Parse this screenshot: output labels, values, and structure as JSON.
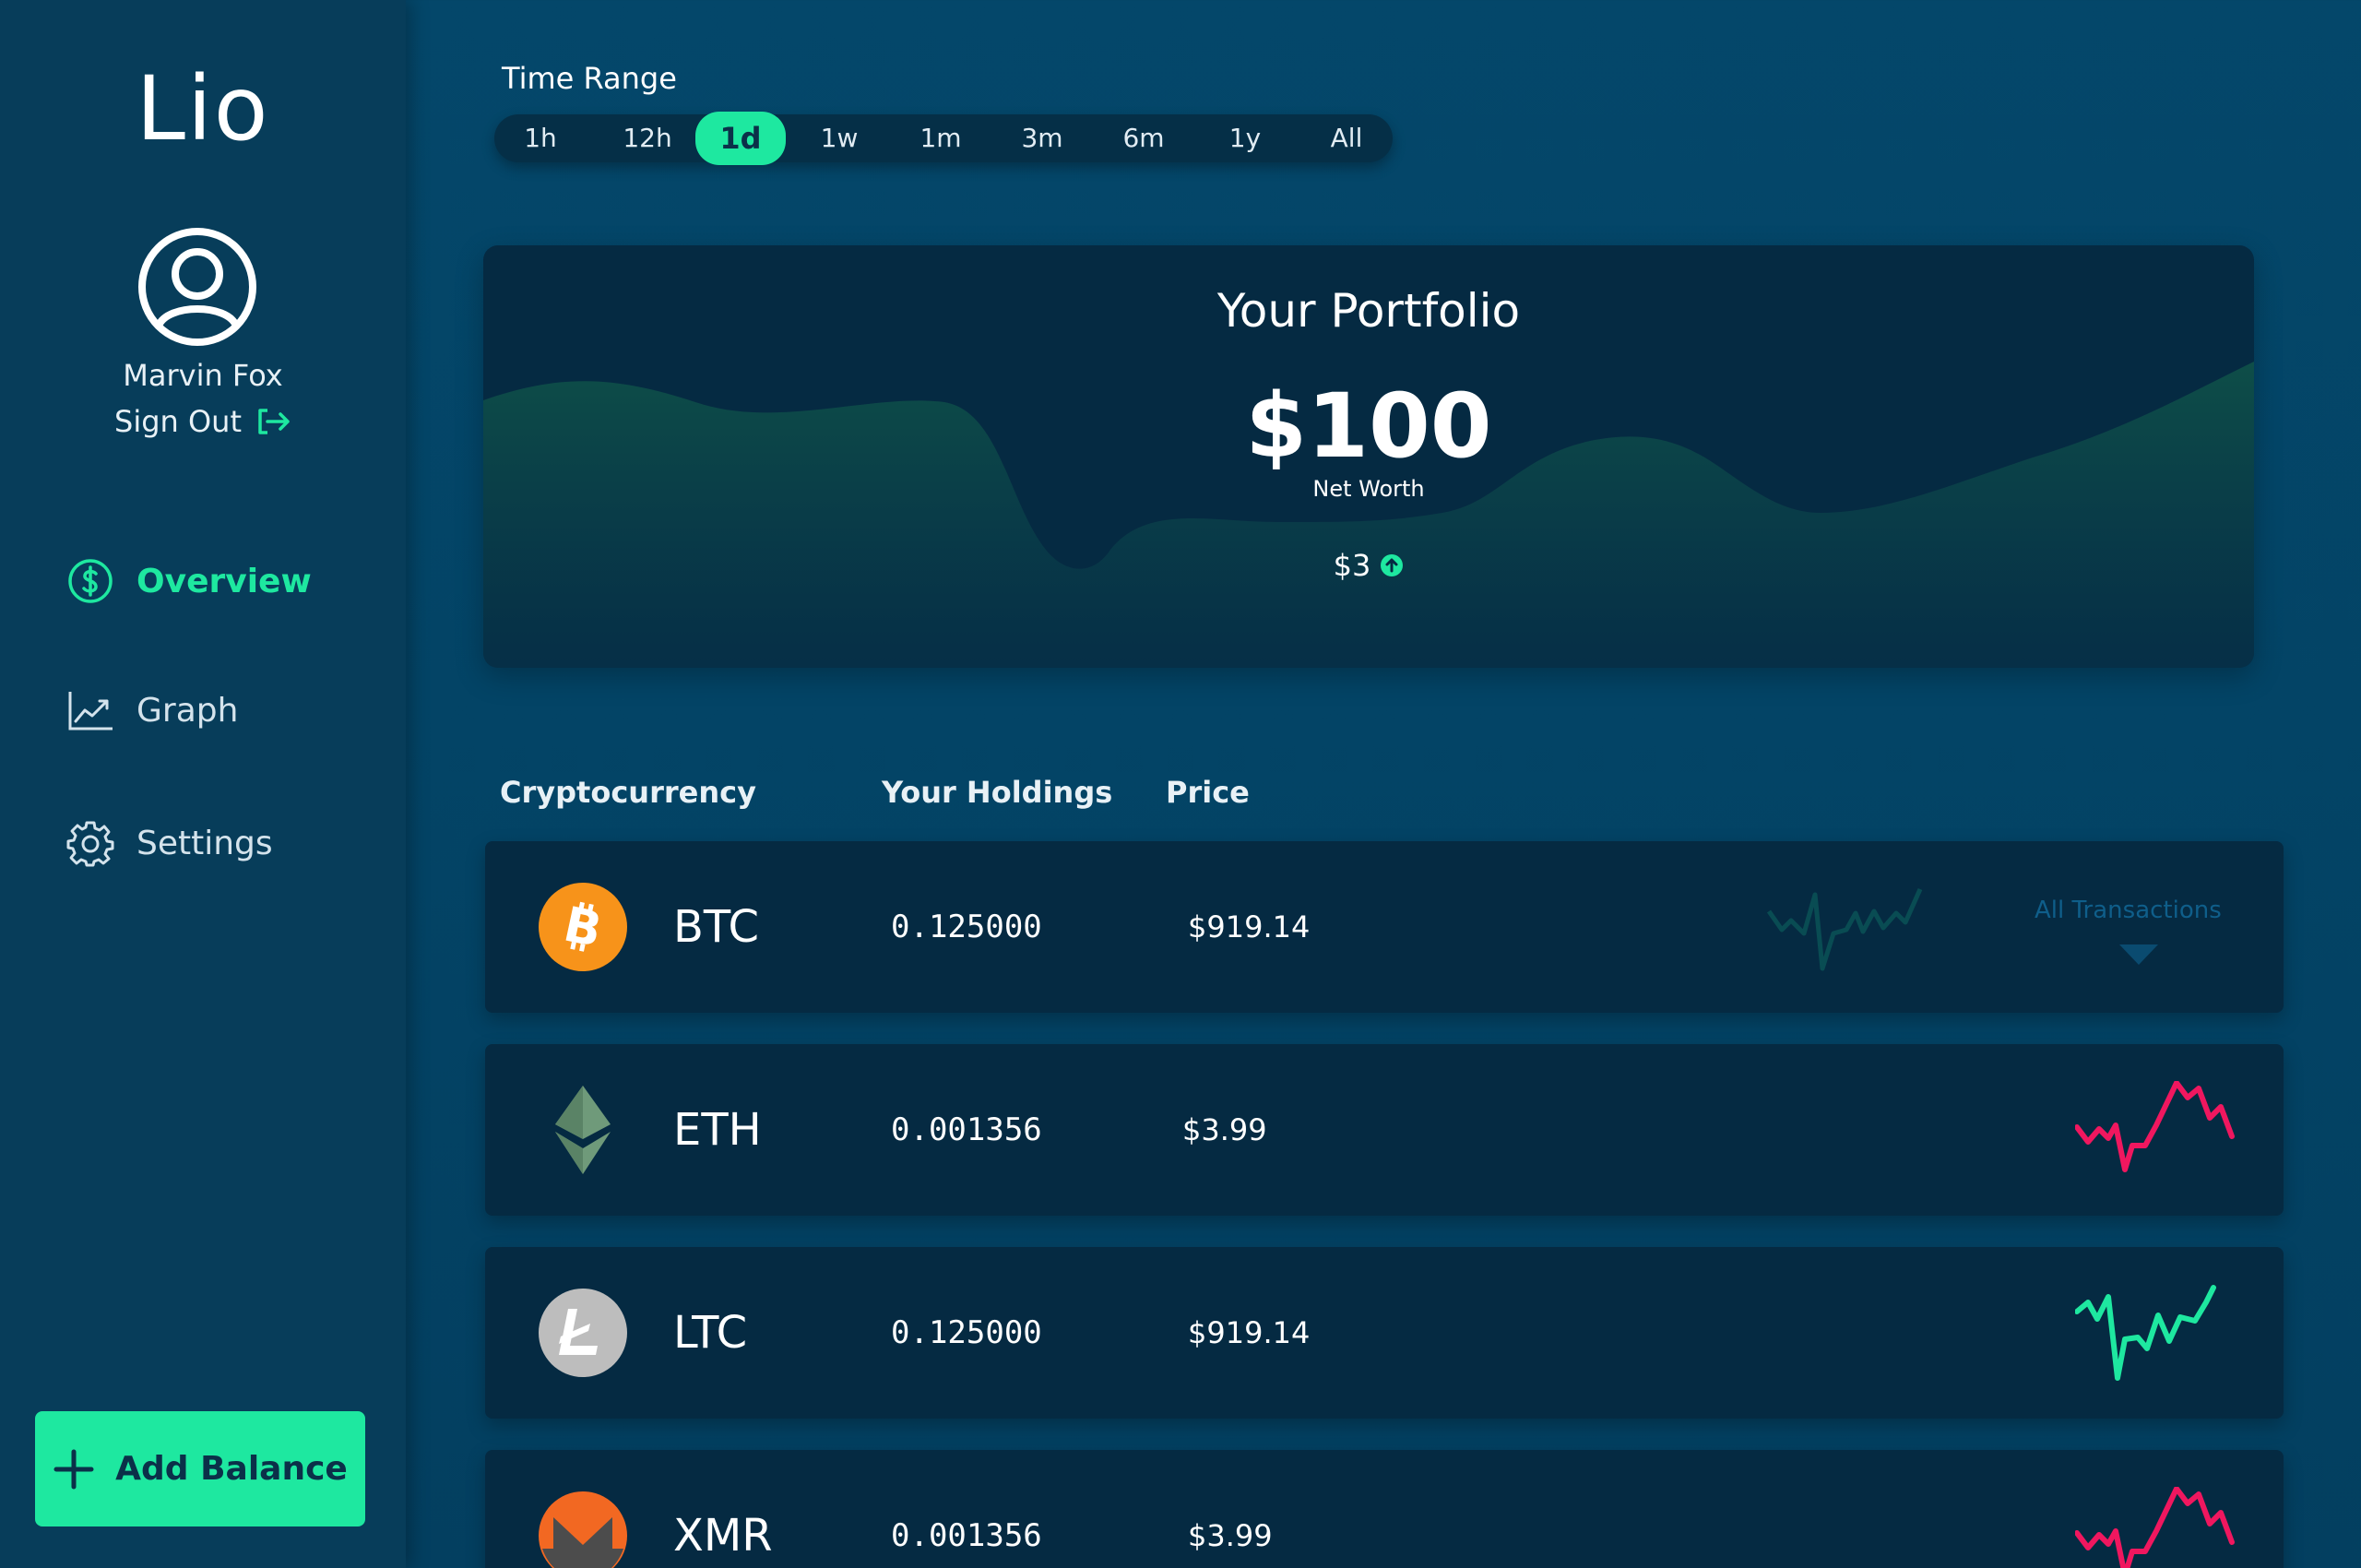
{
  "app": {
    "name": "Lio"
  },
  "user": {
    "name": "Marvin Fox",
    "sign_out_label": "Sign Out"
  },
  "nav": {
    "items": [
      {
        "label": "Overview",
        "icon": "dollar-circle-icon",
        "active": true
      },
      {
        "label": "Graph",
        "icon": "line-chart-icon",
        "active": false
      },
      {
        "label": "Settings",
        "icon": "gear-icon",
        "active": false
      }
    ]
  },
  "add_balance_label": "Add Balance",
  "time_range": {
    "label": "Time Range",
    "options": [
      "1h",
      "12h",
      "1d",
      "1w",
      "1m",
      "3m",
      "6m",
      "1y",
      "All"
    ],
    "selected": "1d"
  },
  "portfolio": {
    "title": "Your Portfolio",
    "value": "$100",
    "subtitle": "Net Worth",
    "change": "$3",
    "change_direction": "up"
  },
  "table": {
    "headers": {
      "crypto": "Cryptocurrency",
      "holdings": "Your Holdings",
      "price": "Price"
    },
    "rows": [
      {
        "symbol": "BTC",
        "holdings": "0.125000",
        "price": "$919.14",
        "icon": "bitcoin-icon",
        "trend": "up",
        "hover_label": "All Transactions"
      },
      {
        "symbol": "ETH",
        "holdings": "0.001356",
        "price": "$3.99",
        "icon": "ethereum-icon",
        "trend": "down"
      },
      {
        "symbol": "LTC",
        "holdings": "0.125000",
        "price": "$919.14",
        "icon": "litecoin-icon",
        "trend": "up"
      },
      {
        "symbol": "XMR",
        "holdings": "0.001356",
        "price": "$3.99",
        "icon": "monero-icon",
        "trend": "down"
      }
    ]
  },
  "colors": {
    "accent": "#1ee8a0",
    "negative": "#f0175f",
    "background": "#034466",
    "panel": "#052a42",
    "sidebar": "#073d5a",
    "bitcoin": "#f7931a",
    "ethereum": "#5f8f6f",
    "litecoin": "#bdbdbd",
    "monero": "#f26822"
  }
}
